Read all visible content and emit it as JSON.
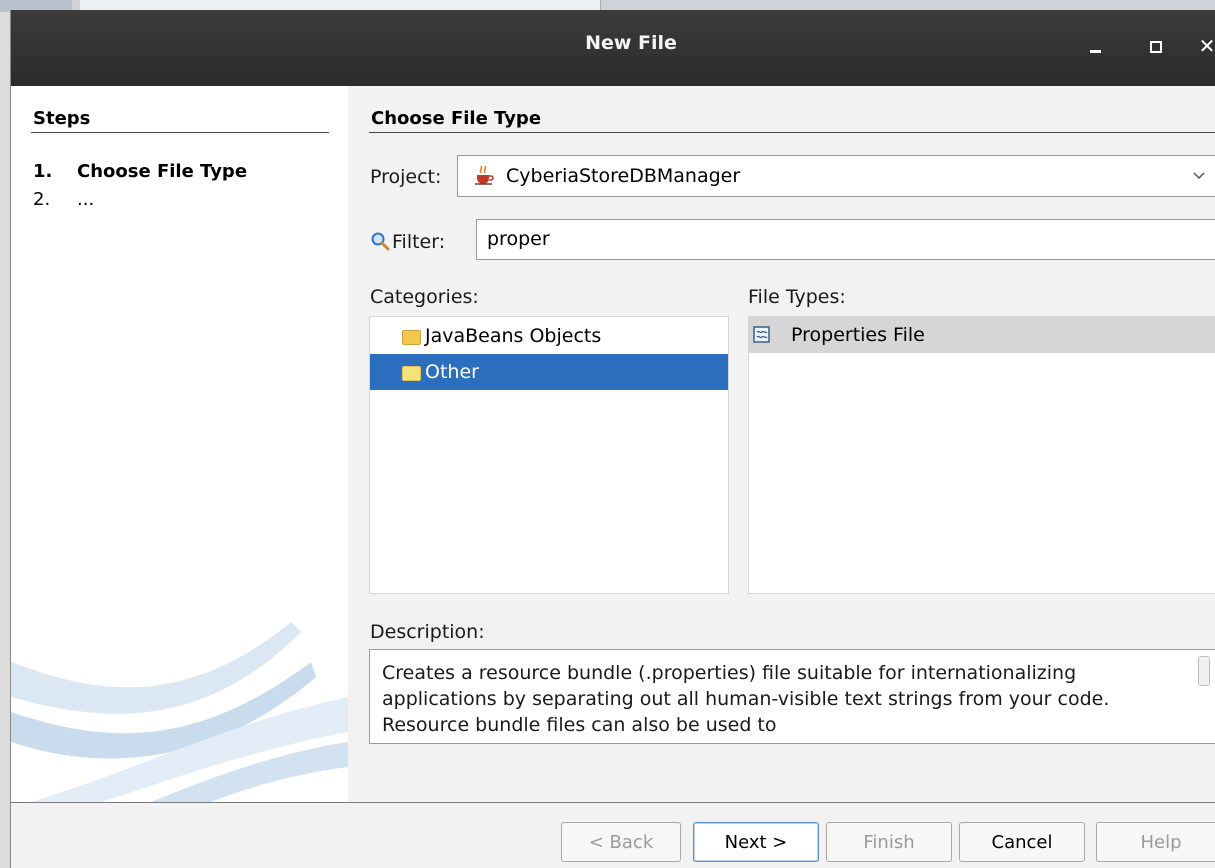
{
  "window": {
    "title": "New File"
  },
  "steps": {
    "heading": "Steps",
    "items": [
      {
        "num": "1.",
        "label": "Choose File Type"
      },
      {
        "num": "2.",
        "label": "..."
      }
    ]
  },
  "main": {
    "heading": "Choose File Type",
    "project": {
      "label": "Project:",
      "value": "CyberiaStoreDBManager"
    },
    "filter": {
      "label": "Filter:",
      "value": "proper"
    },
    "categories": {
      "label": "Categories:",
      "items": [
        {
          "label": "JavaBeans Objects",
          "selected": false
        },
        {
          "label": "Other",
          "selected": true
        }
      ]
    },
    "file_types": {
      "label": "File Types:",
      "items": [
        {
          "label": "Properties File",
          "selected": true
        }
      ]
    },
    "description": {
      "label": "Description:",
      "text": "Creates a resource bundle (.properties) file suitable for internationalizing applications by separating out all human-visible text strings from your code. Resource bundle files can also be used to"
    }
  },
  "buttons": {
    "back": "< Back",
    "next": "Next >",
    "finish": "Finish",
    "cancel": "Cancel",
    "help": "Help"
  },
  "colors": {
    "selection": "#2c6fbf",
    "titlebar": "#2f2f2f"
  }
}
